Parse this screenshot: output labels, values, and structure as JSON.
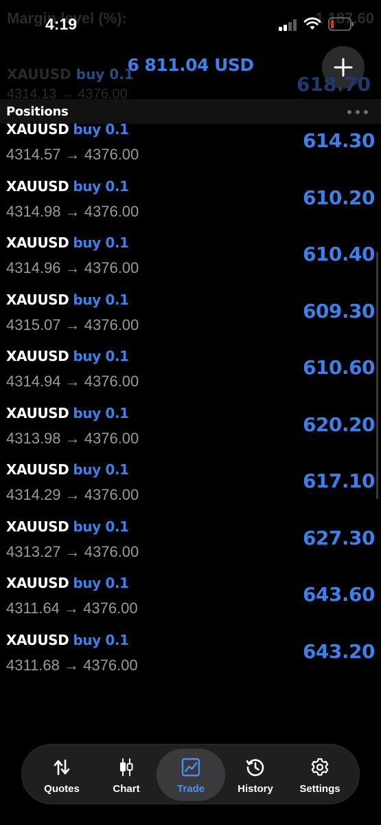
{
  "status_bar": {
    "time": "4:19"
  },
  "header": {
    "balance": "6 811.04 USD"
  },
  "ghost_under_status": {
    "label": "Margin level (%):",
    "value": "1 187.60"
  },
  "ghost_row": {
    "symbol": "XAUUSD",
    "side": "buy 0.1",
    "prices": "4314.13 → 4376.00",
    "profit": "618.70"
  },
  "section": {
    "title": "Positions"
  },
  "positions": [
    {
      "symbol": "XAUUSD",
      "side": "buy 0.1",
      "prices": "4314.57 → 4376.00",
      "profit": "614.30"
    },
    {
      "symbol": "XAUUSD",
      "side": "buy 0.1",
      "prices": "4314.98 → 4376.00",
      "profit": "610.20"
    },
    {
      "symbol": "XAUUSD",
      "side": "buy 0.1",
      "prices": "4314.96 → 4376.00",
      "profit": "610.40"
    },
    {
      "symbol": "XAUUSD",
      "side": "buy 0.1",
      "prices": "4315.07 → 4376.00",
      "profit": "609.30"
    },
    {
      "symbol": "XAUUSD",
      "side": "buy 0.1",
      "prices": "4314.94 → 4376.00",
      "profit": "610.60"
    },
    {
      "symbol": "XAUUSD",
      "side": "buy 0.1",
      "prices": "4313.98 → 4376.00",
      "profit": "620.20"
    },
    {
      "symbol": "XAUUSD",
      "side": "buy 0.1",
      "prices": "4314.29 → 4376.00",
      "profit": "617.10"
    },
    {
      "symbol": "XAUUSD",
      "side": "buy 0.1",
      "prices": "4313.27 → 4376.00",
      "profit": "627.30"
    },
    {
      "symbol": "XAUUSD",
      "side": "buy 0.1",
      "prices": "4311.64 → 4376.00",
      "profit": "643.60"
    },
    {
      "symbol": "XAUUSD",
      "side": "buy 0.1",
      "prices": "4311.68 → 4376.00",
      "profit": "643.20"
    }
  ],
  "tabs": [
    {
      "label": "Quotes",
      "icon": "arrows-up-down-icon"
    },
    {
      "label": "Chart",
      "icon": "candlestick-icon"
    },
    {
      "label": "Trade",
      "icon": "trend-chart-icon",
      "active": true
    },
    {
      "label": "History",
      "icon": "history-clock-icon"
    },
    {
      "label": "Settings",
      "icon": "gear-icon"
    }
  ],
  "colors": {
    "accent": "#3f7fe8",
    "background": "#000000",
    "muted_text": "#9a9a9a",
    "battery_low": "#e0302a"
  }
}
